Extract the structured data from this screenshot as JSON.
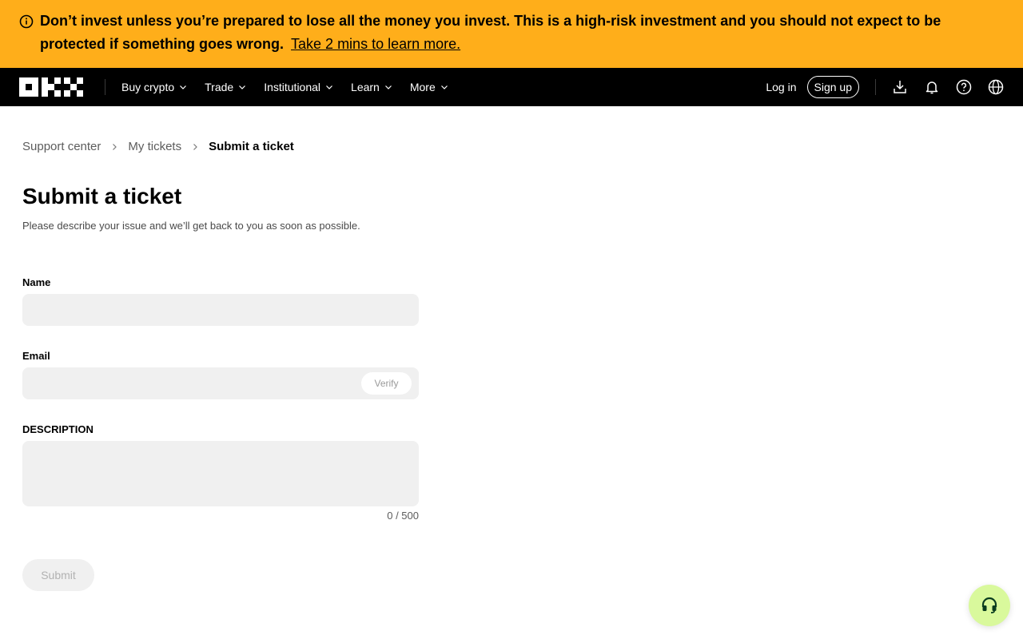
{
  "colors": {
    "banner_bg": "#ffae1a",
    "nav_bg": "#000000",
    "support_bg": "#d9f99c"
  },
  "banner": {
    "icon": "info-circle-icon",
    "message": "Don’t invest unless you’re prepared to lose all the money you invest. This is a high-risk investment and you should not expect to be protected if something goes wrong.",
    "link": "Take 2 mins to learn more."
  },
  "nav": {
    "logo": "OKX",
    "menu": [
      {
        "label": "Buy crypto"
      },
      {
        "label": "Trade"
      },
      {
        "label": "Institutional"
      },
      {
        "label": "Learn"
      },
      {
        "label": "More"
      }
    ],
    "login": "Log in",
    "signup": "Sign up",
    "icons": [
      "download-icon",
      "bell-icon",
      "help-icon",
      "globe-icon"
    ]
  },
  "breadcrumb": {
    "items": [
      "Support center",
      "My tickets",
      "Submit a ticket"
    ]
  },
  "page": {
    "title": "Submit a ticket",
    "subtitle": "Please describe your issue and we’ll get back to you as soon as possible."
  },
  "form": {
    "name": {
      "label": "Name",
      "value": ""
    },
    "email": {
      "label": "Email",
      "value": "",
      "verify": "Verify"
    },
    "description": {
      "label": "DESCRIPTION",
      "value": "",
      "counter": "0 / 500"
    },
    "submit": "Submit"
  },
  "support": {
    "icon": "headset-icon"
  }
}
